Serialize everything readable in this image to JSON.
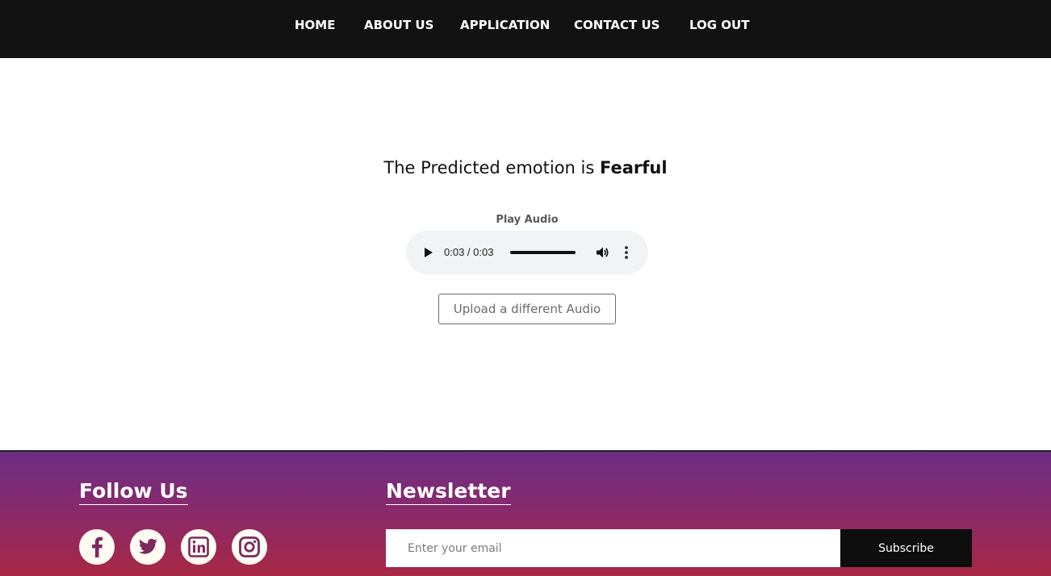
{
  "nav": {
    "items": [
      {
        "label": "HOME"
      },
      {
        "label": "ABOUT US"
      },
      {
        "label": "APPLICATION"
      },
      {
        "label": "CONTACT US"
      },
      {
        "label": "LOG OUT"
      }
    ]
  },
  "result": {
    "prefix": "The Predicted emotion is",
    "emotion": "Fearful"
  },
  "audio": {
    "label": "Play Audio",
    "time": "0:03 / 0:03",
    "progress_fraction": 1.0
  },
  "upload_button": "Upload a different Audio",
  "footer": {
    "follow_heading": "Follow Us",
    "social_icons": [
      "facebook-icon",
      "twitter-icon",
      "linkedin-icon",
      "instagram-icon"
    ],
    "newsletter_heading": "Newsletter",
    "email_placeholder": "Enter your email",
    "subscribe_label": "Subscribe"
  },
  "colors": {
    "navbar": "#121212",
    "footer_top": "#6c2d84",
    "footer_bottom": "#a82744",
    "icon_bg": "#fffaf2"
  }
}
